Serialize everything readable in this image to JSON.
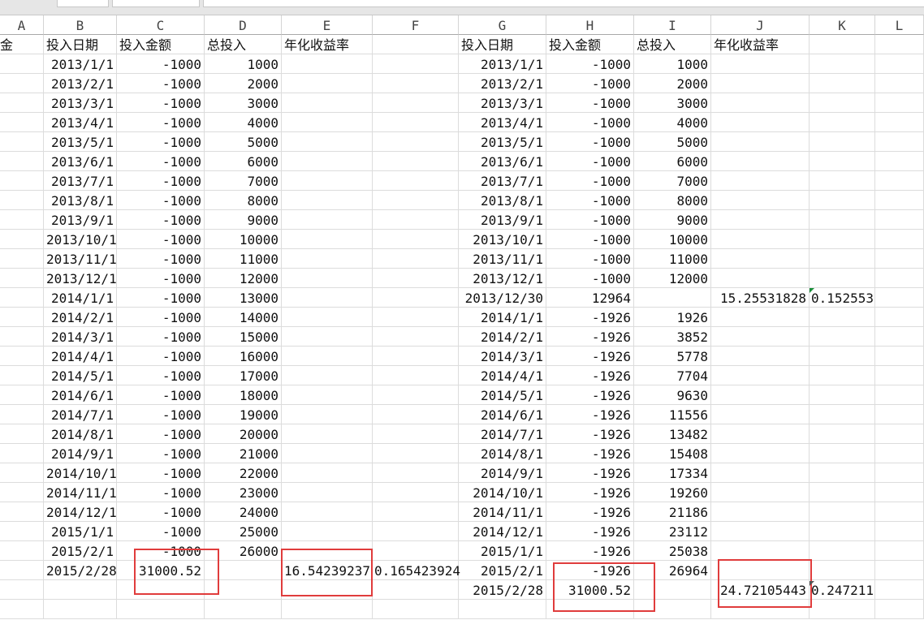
{
  "columns": [
    "A",
    "B",
    "C",
    "D",
    "E",
    "F",
    "G",
    "H",
    "I",
    "J",
    "K",
    "L"
  ],
  "rows": [
    [
      "金",
      "投入日期",
      "投入金额",
      "总投入",
      "年化收益率",
      "",
      "投入日期",
      "投入金额",
      "总投入",
      "年化收益率",
      "",
      ""
    ],
    [
      "",
      "2013/1/1",
      "-1000",
      "1000",
      "",
      "",
      "2013/1/1",
      "-1000",
      "1000",
      "",
      "",
      ""
    ],
    [
      "",
      "2013/2/1",
      "-1000",
      "2000",
      "",
      "",
      "2013/2/1",
      "-1000",
      "2000",
      "",
      "",
      ""
    ],
    [
      "",
      "2013/3/1",
      "-1000",
      "3000",
      "",
      "",
      "2013/3/1",
      "-1000",
      "3000",
      "",
      "",
      ""
    ],
    [
      "",
      "2013/4/1",
      "-1000",
      "4000",
      "",
      "",
      "2013/4/1",
      "-1000",
      "4000",
      "",
      "",
      ""
    ],
    [
      "",
      "2013/5/1",
      "-1000",
      "5000",
      "",
      "",
      "2013/5/1",
      "-1000",
      "5000",
      "",
      "",
      ""
    ],
    [
      "",
      "2013/6/1",
      "-1000",
      "6000",
      "",
      "",
      "2013/6/1",
      "-1000",
      "6000",
      "",
      "",
      ""
    ],
    [
      "",
      "2013/7/1",
      "-1000",
      "7000",
      "",
      "",
      "2013/7/1",
      "-1000",
      "7000",
      "",
      "",
      ""
    ],
    [
      "",
      "2013/8/1",
      "-1000",
      "8000",
      "",
      "",
      "2013/8/1",
      "-1000",
      "8000",
      "",
      "",
      ""
    ],
    [
      "",
      "2013/9/1",
      "-1000",
      "9000",
      "",
      "",
      "2013/9/1",
      "-1000",
      "9000",
      "",
      "",
      ""
    ],
    [
      "",
      "2013/10/1",
      "-1000",
      "10000",
      "",
      "",
      "2013/10/1",
      "-1000",
      "10000",
      "",
      "",
      ""
    ],
    [
      "",
      "2013/11/1",
      "-1000",
      "11000",
      "",
      "",
      "2013/11/1",
      "-1000",
      "11000",
      "",
      "",
      ""
    ],
    [
      "",
      "2013/12/1",
      "-1000",
      "12000",
      "",
      "",
      "2013/12/1",
      "-1000",
      "12000",
      "",
      "",
      ""
    ],
    [
      "",
      "2014/1/1",
      "-1000",
      "13000",
      "",
      "",
      "2013/12/30",
      "12964",
      "",
      "15.25531828",
      "0.152553",
      ""
    ],
    [
      "",
      "2014/2/1",
      "-1000",
      "14000",
      "",
      "",
      "2014/1/1",
      "-1926",
      "1926",
      "",
      "",
      ""
    ],
    [
      "",
      "2014/3/1",
      "-1000",
      "15000",
      "",
      "",
      "2014/2/1",
      "-1926",
      "3852",
      "",
      "",
      ""
    ],
    [
      "",
      "2014/4/1",
      "-1000",
      "16000",
      "",
      "",
      "2014/3/1",
      "-1926",
      "5778",
      "",
      "",
      ""
    ],
    [
      "",
      "2014/5/1",
      "-1000",
      "17000",
      "",
      "",
      "2014/4/1",
      "-1926",
      "7704",
      "",
      "",
      ""
    ],
    [
      "",
      "2014/6/1",
      "-1000",
      "18000",
      "",
      "",
      "2014/5/1",
      "-1926",
      "9630",
      "",
      "",
      ""
    ],
    [
      "",
      "2014/7/1",
      "-1000",
      "19000",
      "",
      "",
      "2014/6/1",
      "-1926",
      "11556",
      "",
      "",
      ""
    ],
    [
      "",
      "2014/8/1",
      "-1000",
      "20000",
      "",
      "",
      "2014/7/1",
      "-1926",
      "13482",
      "",
      "",
      ""
    ],
    [
      "",
      "2014/9/1",
      "-1000",
      "21000",
      "",
      "",
      "2014/8/1",
      "-1926",
      "15408",
      "",
      "",
      ""
    ],
    [
      "",
      "2014/10/1",
      "-1000",
      "22000",
      "",
      "",
      "2014/9/1",
      "-1926",
      "17334",
      "",
      "",
      ""
    ],
    [
      "",
      "2014/11/1",
      "-1000",
      "23000",
      "",
      "",
      "2014/10/1",
      "-1926",
      "19260",
      "",
      "",
      ""
    ],
    [
      "",
      "2014/12/1",
      "-1000",
      "24000",
      "",
      "",
      "2014/11/1",
      "-1926",
      "21186",
      "",
      "",
      ""
    ],
    [
      "",
      "2015/1/1",
      "-1000",
      "25000",
      "",
      "",
      "2014/12/1",
      "-1926",
      "23112",
      "",
      "",
      ""
    ],
    [
      "",
      "2015/2/1",
      "-1000",
      "26000",
      "",
      "",
      "2015/1/1",
      "-1926",
      "25038",
      "",
      "",
      ""
    ],
    [
      "",
      "2015/2/28",
      "31000.52",
      "",
      "16.54239237",
      "0.165423924",
      "2015/2/1",
      "-1926",
      "26964",
      "",
      "",
      ""
    ],
    [
      "",
      "",
      "",
      "",
      "",
      "",
      "2015/2/28",
      "31000.52",
      "",
      "24.72105443",
      "0.247211",
      ""
    ],
    [
      "",
      "",
      "",
      "",
      "",
      "",
      "",
      "",
      "",
      "",
      "",
      ""
    ]
  ],
  "highlight_color": "#e03c3c"
}
